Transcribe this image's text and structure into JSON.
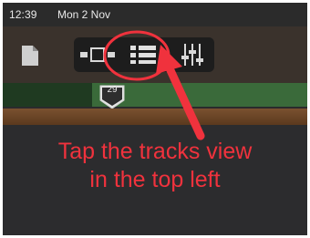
{
  "status_bar": {
    "time": "12:39",
    "date": "Mon 2 Nov"
  },
  "toolbar": {
    "buttons": [
      {
        "icon": "document-icon"
      },
      {
        "icon": "live-loops-icon"
      },
      {
        "icon": "tracks-view-icon",
        "highlighted": true
      },
      {
        "icon": "mixer-icon"
      }
    ]
  },
  "timeline": {
    "playhead_bar": "29"
  },
  "annotation": {
    "line1": "Tap the tracks view",
    "line2": "in the top left",
    "color": "#f0323d"
  }
}
